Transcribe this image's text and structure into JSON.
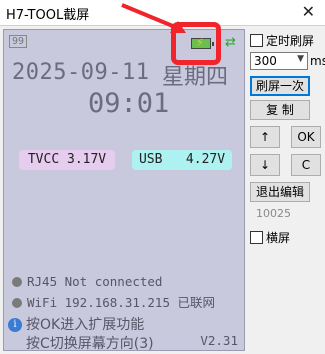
{
  "window": {
    "title": "H7-TOOL截屏",
    "close_label": "✕"
  },
  "screen": {
    "badge": "99",
    "date": "2025-09-11",
    "weekday": "星期四",
    "time": "09:01",
    "tvcc": "TVCC 3.17V",
    "usb": "USB   4.27V",
    "rj45": "RJ45 Not connected",
    "wifi": "WiFi 192.168.31.215 已联网",
    "hint1": "按OK进入扩展功能",
    "hint2": "按C切换屏幕方向(3)",
    "version": "V2.31"
  },
  "panel": {
    "timed_refresh_label": "定时刷屏",
    "interval_value": "300",
    "interval_unit": "ms",
    "refresh_once": "刷屏一次",
    "copy": "复 制",
    "up": "↑",
    "ok": "OK",
    "down": "↓",
    "c": "C",
    "exit_edit": "退出编辑",
    "value": "10025",
    "landscape_label": "横屏"
  },
  "colors": {
    "highlight": "#f0242a",
    "screen_bg": "#c9c9de",
    "tvcc_bg": "#e6ccee",
    "usb_bg": "#aef1f1"
  }
}
